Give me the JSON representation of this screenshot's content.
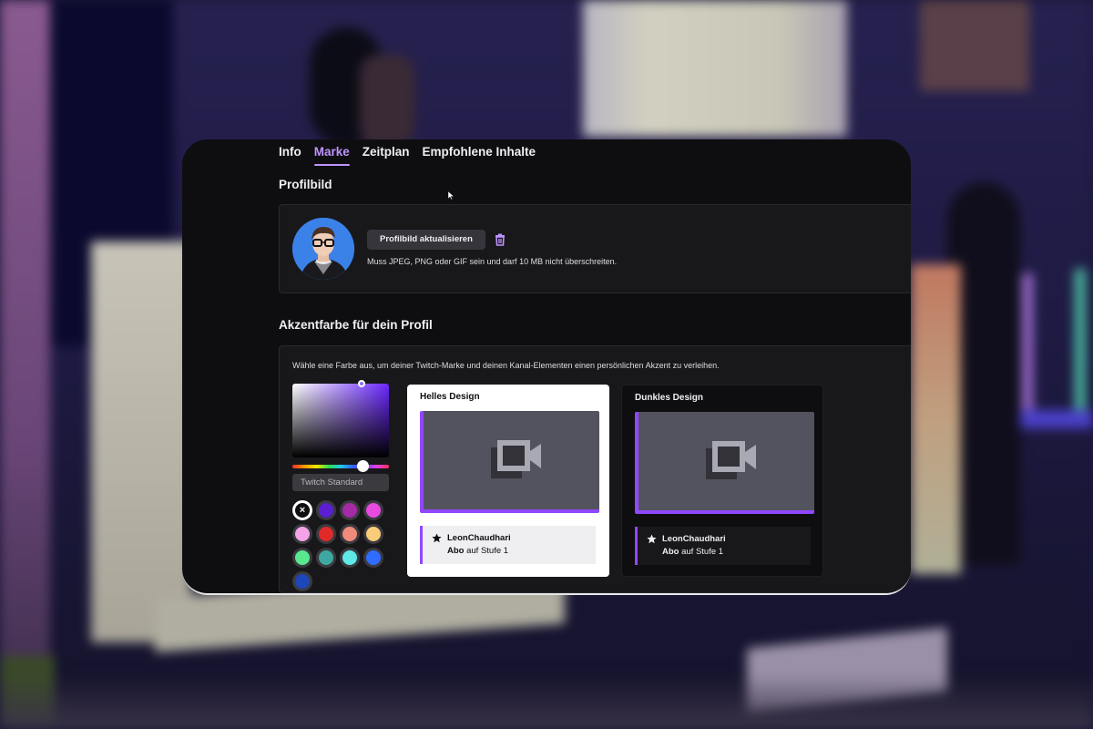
{
  "tabs": [
    {
      "label": "Info",
      "active": false
    },
    {
      "label": "Marke",
      "active": true
    },
    {
      "label": "Zeitplan",
      "active": false
    },
    {
      "label": "Empfohlene Inhalte",
      "active": false
    }
  ],
  "profile_section": {
    "title": "Profilbild",
    "update_button": "Profilbild aktualisieren",
    "delete_icon": "trash-icon",
    "hint": "Muss JPEG, PNG oder GIF sein und darf 10 MB nicht überschreiten."
  },
  "accent_section": {
    "title": "Akzentfarbe für dein Profil",
    "description": "Wähle eine Farbe aus, um deiner Twitch-Marke und deinen Kanal-Elementen einen persönlichen Akzent zu verleihen.",
    "picker": {
      "preset_value": "Twitch Standard",
      "hue_position": 0.72,
      "saturation": 0.72,
      "brightness": 1.0
    },
    "swatches": [
      {
        "name": "clear",
        "color": "#ffffff",
        "selected": true
      },
      {
        "name": "purple",
        "color": "#5b1fd1",
        "selected": false
      },
      {
        "name": "magenta",
        "color": "#a42aa6",
        "selected": false
      },
      {
        "name": "pink",
        "color": "#e84ae0",
        "selected": false
      },
      {
        "name": "light-pink",
        "color": "#f5a3e8",
        "selected": false
      },
      {
        "name": "red",
        "color": "#e02a2a",
        "selected": false
      },
      {
        "name": "salmon",
        "color": "#f08a7a",
        "selected": false
      },
      {
        "name": "yellow",
        "color": "#f8cc78",
        "selected": false
      },
      {
        "name": "green",
        "color": "#5ae88e",
        "selected": false
      },
      {
        "name": "teal",
        "color": "#3ea8a0",
        "selected": false
      },
      {
        "name": "cyan",
        "color": "#5ee8e6",
        "selected": false
      },
      {
        "name": "blue",
        "color": "#2f6cff",
        "selected": false
      },
      {
        "name": "dark-blue",
        "color": "#1d47b8",
        "selected": false
      }
    ],
    "light_design": {
      "title": "Helles Design",
      "username": "LeonChaudhari",
      "tier_bold": "Abo",
      "tier_rest": " auf Stufe 1"
    },
    "dark_design": {
      "title": "Dunkles Design",
      "username": "LeonChaudhari",
      "tier_bold": "Abo",
      "tier_rest": " auf Stufe 1"
    }
  },
  "colors": {
    "accent": "#9147ff",
    "tab_active": "#bf94ff",
    "panel_bg": "#0e0e10",
    "box_bg": "#18181b"
  }
}
